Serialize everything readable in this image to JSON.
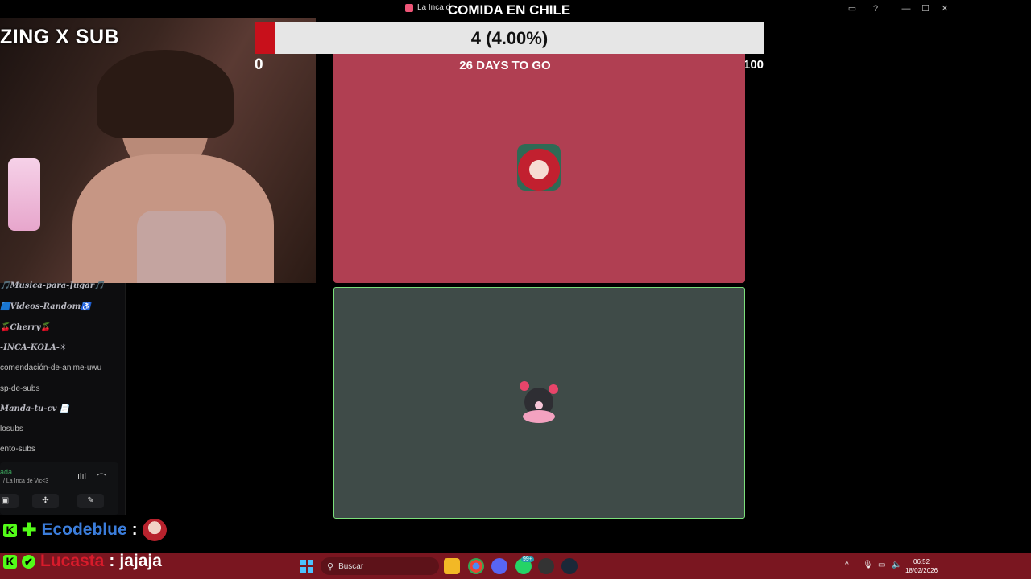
{
  "window": {
    "app_title": "La Inca d",
    "controls": [
      "▭",
      "?",
      "—",
      "☐",
      "✕"
    ]
  },
  "goal": {
    "title": "COMIDA EN CHILE",
    "progress_text": "4 (4.00%)",
    "progress_fraction": 0.04,
    "min": "0",
    "max": "100",
    "days_left": "26 DAYS TO GO",
    "fill_color": "#c8101b"
  },
  "overlay": {
    "subathon_text": "ZING X SUB"
  },
  "channels": [
    {
      "label": "🎵Musica-para-Jugar🎵",
      "style": "it"
    },
    {
      "label": "🟦Videos-Random♿",
      "style": "it"
    },
    {
      "label": "🍒Cherry🍒",
      "style": "it"
    },
    {
      "label": "-INCA-KOLA-☀",
      "style": "it"
    },
    {
      "label": "comendación-de-anime-uwu",
      "style": "plain"
    },
    {
      "label": "sp-de-subs",
      "style": "plain"
    },
    {
      "label": "Manda-tu-cv 📄",
      "style": "it"
    },
    {
      "label": "losubs",
      "style": "plain"
    },
    {
      "label": "ento-subs",
      "style": "plain"
    }
  ],
  "voice": {
    "status": "ada",
    "channel": "/ La Inca de Vic<3"
  },
  "chat": [
    {
      "user": "Ecodeblue",
      "sep": ":",
      "message": "",
      "user_color": "#3b7ddb"
    },
    {
      "user": "Lucasta",
      "sep": ":",
      "message": "jajaja",
      "user_color": "#d81b2b"
    }
  ],
  "taskbar": {
    "search_placeholder": "Buscar",
    "time": "06:52",
    "date": "18/02/2026",
    "notif_badge": "99+"
  }
}
